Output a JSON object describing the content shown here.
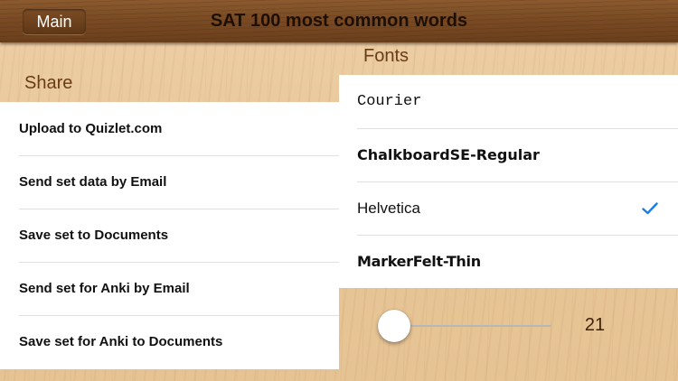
{
  "navbar": {
    "back_label": "Main",
    "title": "SAT 100 most common words"
  },
  "share": {
    "header": "Share",
    "items": [
      {
        "label": "Upload to Quizlet.com"
      },
      {
        "label": "Send set data by Email"
      },
      {
        "label": "Save set to Documents"
      },
      {
        "label": "Send set for Anki by Email"
      },
      {
        "label": "Save set for Anki to Documents"
      }
    ]
  },
  "fonts": {
    "header": "Fonts",
    "items": [
      {
        "label": "Courier",
        "selected": false
      },
      {
        "label": "ChalkboardSE-Regular",
        "selected": false
      },
      {
        "label": "Helvetica",
        "selected": true
      },
      {
        "label": "MarkerFelt-Thin",
        "selected": false
      }
    ],
    "check_icon": "checkmark-icon",
    "check_color": "#1a7ee6"
  },
  "font_size": {
    "value": "21",
    "slider_level": 0.0
  },
  "colors": {
    "navbar_wood": "#7a4b24",
    "background_wood": "#e8c597",
    "header_text": "#6a3c16"
  }
}
